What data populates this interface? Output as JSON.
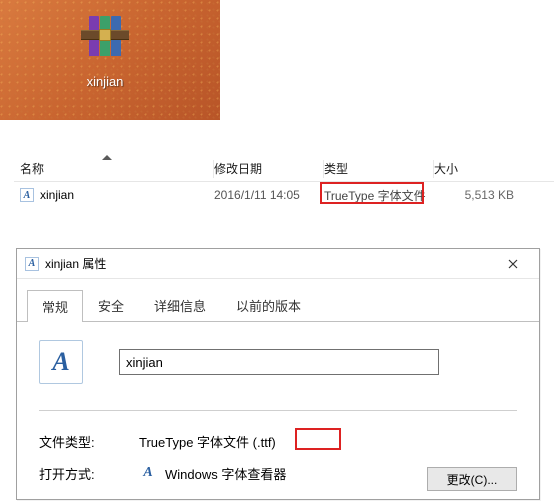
{
  "desktop": {
    "icon_label": "xinjian"
  },
  "file_list": {
    "headers": {
      "name": "名称",
      "date": "修改日期",
      "type": "类型",
      "size": "大小"
    },
    "row": {
      "name": "xinjian",
      "date": "2016/1/11 14:05",
      "type": "TrueType 字体文件",
      "size": "5,513 KB"
    }
  },
  "dialog": {
    "title": "xinjian 属性",
    "tabs": {
      "general": "常规",
      "security": "安全",
      "details": "详细信息",
      "previous": "以前的版本"
    },
    "filename": "xinjian",
    "labels": {
      "file_type": "文件类型:",
      "open_with": "打开方式:"
    },
    "values": {
      "file_type": "TrueType 字体文件 (.ttf)",
      "open_with_app": "Windows 字体查看器"
    },
    "change_button": "更改(C)..."
  }
}
